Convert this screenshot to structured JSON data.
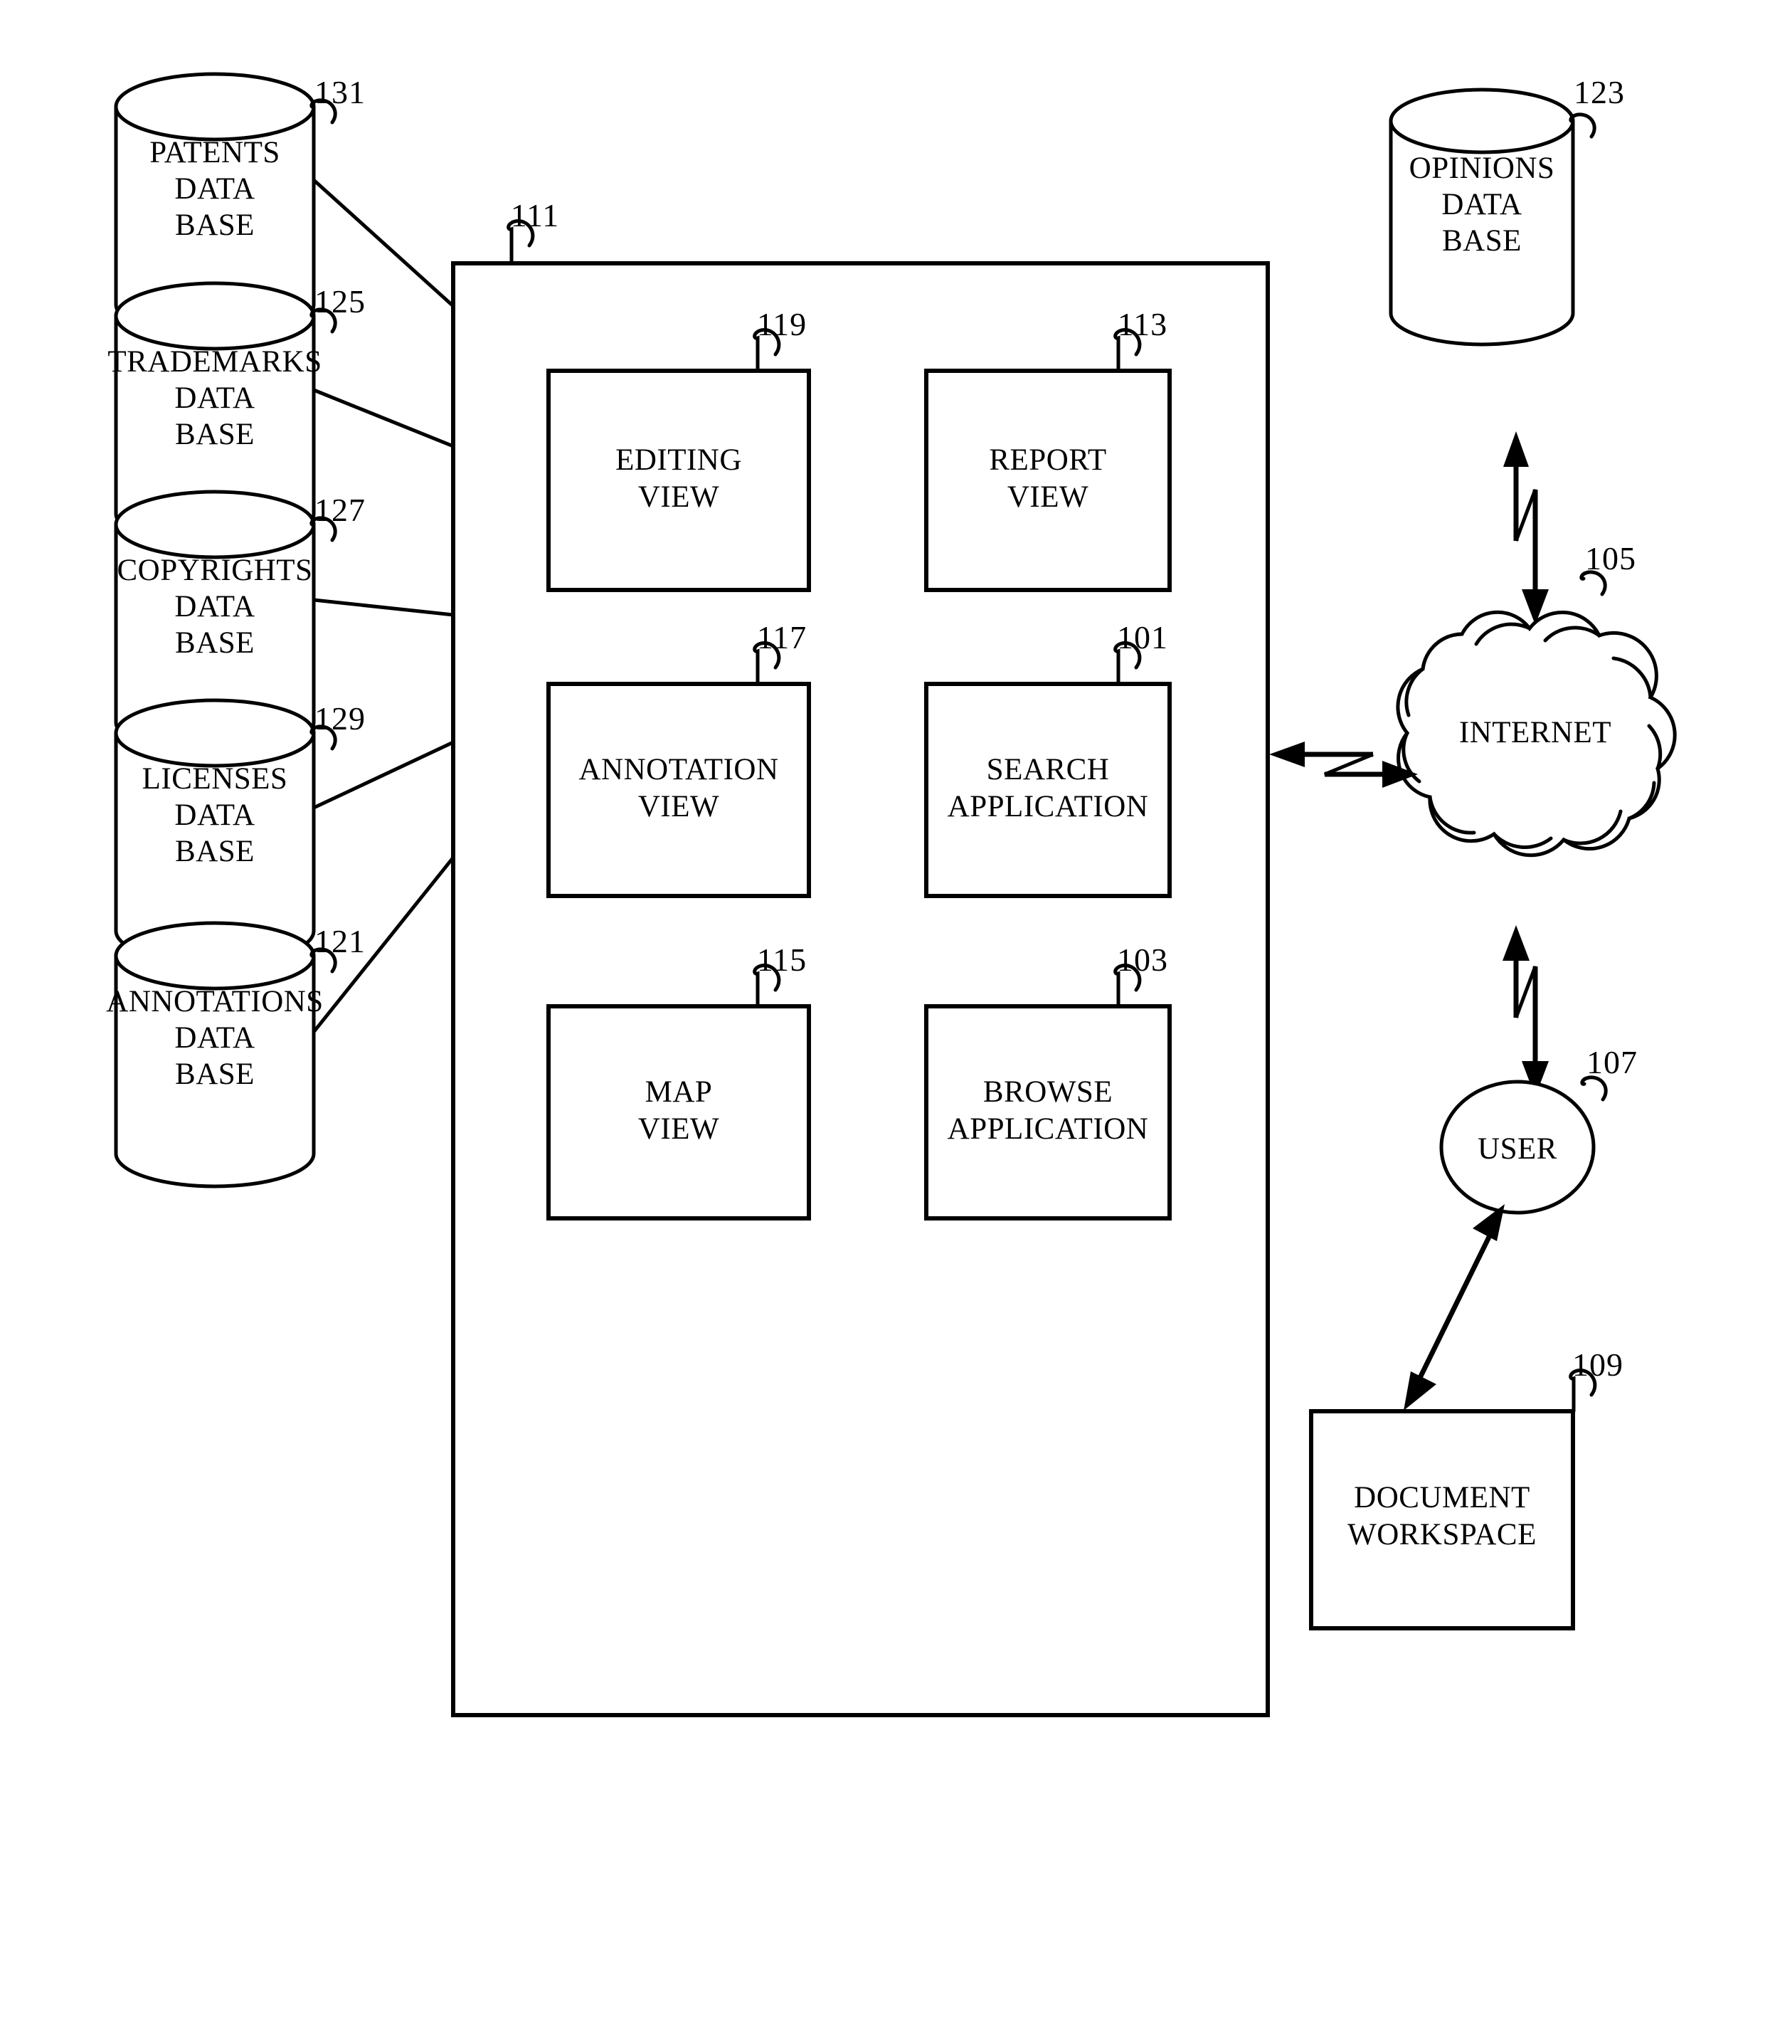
{
  "figure": {
    "title": "System architecture block diagram",
    "ink_color": "#000000",
    "background_color": "#ffffff"
  },
  "left_databases": [
    {
      "ref": "131",
      "line1": "PATENTS",
      "line2": "DATA",
      "line3": "BASE"
    },
    {
      "ref": "125",
      "line1": "TRADEMARKS",
      "line2": "DATA",
      "line3": "BASE"
    },
    {
      "ref": "127",
      "line1": "COPYRIGHTS",
      "line2": "DATA",
      "line3": "BASE"
    },
    {
      "ref": "129",
      "line1": "LICENSES",
      "line2": "DATA",
      "line3": "BASE"
    },
    {
      "ref": "121",
      "line1": "ANNOTATIONS",
      "line2": "DATA",
      "line3": "BASE"
    }
  ],
  "system_container": {
    "ref": "111"
  },
  "modules": [
    {
      "ref": "119",
      "line1": "EDITING",
      "line2": "VIEW"
    },
    {
      "ref": "113",
      "line1": "REPORT",
      "line2": "VIEW"
    },
    {
      "ref": "117",
      "line1": "ANNOTATION",
      "line2": "VIEW"
    },
    {
      "ref": "101",
      "line1": "SEARCH",
      "line2": "APPLICATION"
    },
    {
      "ref": "115",
      "line1": "MAP",
      "line2": "VIEW"
    },
    {
      "ref": "103",
      "line1": "BROWSE",
      "line2": "APPLICATION"
    }
  ],
  "right_nodes": {
    "opinions_db": {
      "ref": "123",
      "line1": "OPINIONS",
      "line2": "DATA",
      "line3": "BASE"
    },
    "internet": {
      "ref": "105",
      "label": "INTERNET"
    },
    "user": {
      "ref": "107",
      "label": "USER"
    },
    "document_workspace": {
      "ref": "109",
      "line1": "DOCUMENT",
      "line2": "WORKSPACE"
    }
  }
}
